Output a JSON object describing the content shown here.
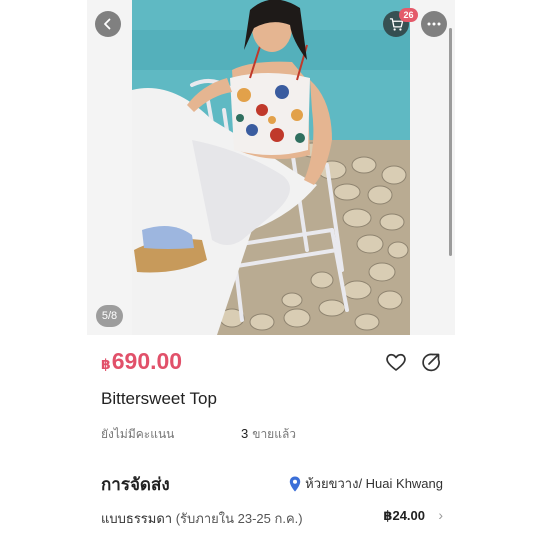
{
  "gallery": {
    "counter": "5/8",
    "cart_badge": "26"
  },
  "product": {
    "currency": "฿",
    "price": "690.00",
    "title": "Bittersweet Top",
    "rating_text": "ยังไม่มีคะแนน",
    "sold_count": "3",
    "sold_label": "ขายแล้ว"
  },
  "shipping": {
    "heading": "การจัดส่ง",
    "location": "ห้วยขวาง/ Huai Khwang",
    "method": "แบบธรรมดา",
    "estimate": "(รับภายใน 23-25 ก.ค.)",
    "fee": "฿24.00"
  },
  "icons": {
    "back": "chevron-left-icon",
    "cart": "shopping-cart-icon",
    "more": "more-horizontal-icon",
    "like": "heart-icon",
    "share": "share-icon",
    "location": "map-pin-icon",
    "next": "chevron-right-icon"
  },
  "colors": {
    "price": "#e1516a",
    "badge": "#e45a6a",
    "pin": "#3b6fd8"
  }
}
